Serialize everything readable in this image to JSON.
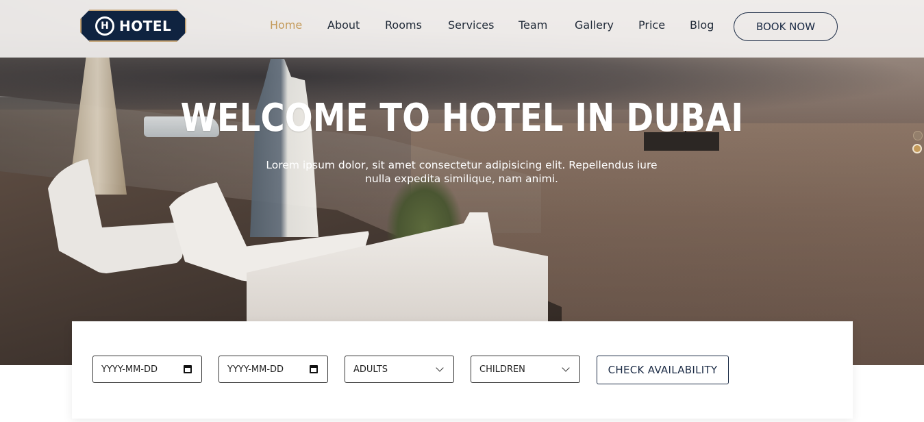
{
  "brand": {
    "logo_text": "HOTEL",
    "logo_badge": "H"
  },
  "nav": {
    "items": [
      {
        "label": "Home",
        "active": true
      },
      {
        "label": "About",
        "active": false
      },
      {
        "label": "Rooms",
        "active": false
      },
      {
        "label": "Services",
        "active": false
      },
      {
        "label": "Team",
        "active": false
      },
      {
        "label": "Gallery",
        "active": false
      },
      {
        "label": "Price",
        "active": false
      },
      {
        "label": "Blog",
        "active": false
      }
    ],
    "book_label": "BOOK NOW"
  },
  "hero": {
    "title": "WELCOME TO HOTEL IN DUBAI",
    "subtitle": "Lorem ipsum dolor, sit amet consectetur adipisicing elit. Repellendus iure nulla expedita similique, nam animi.",
    "slides": 2,
    "active_slide": 2
  },
  "booking": {
    "checkin_placeholder": "YYYY-MM-DD",
    "checkout_placeholder": "YYYY-MM-DD",
    "adults_label": "ADULTS",
    "children_label": "CHILDREN",
    "check_label": "CHECK AVAILABILITY"
  },
  "icons": {
    "calendar": "calendar-icon",
    "dropdown": "chevron-down-icon"
  },
  "colors": {
    "accent": "#c49a5a",
    "navy": "#0f2340",
    "nav_text": "#1f2937"
  }
}
